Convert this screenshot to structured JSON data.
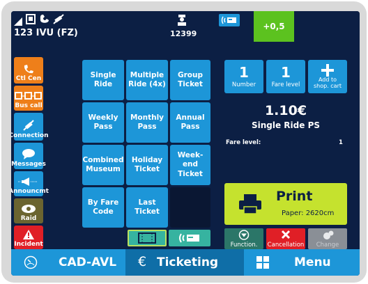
{
  "status": {
    "device_label": "123 IVU (FZ)",
    "driver_id": "12399",
    "balance": "+0,5",
    "balance_color": "#5cc21f"
  },
  "sidebar": {
    "items": [
      {
        "label": "Ctl Cen",
        "color": "#ee7f1a",
        "icon": "phone-icon"
      },
      {
        "label": "Bus call",
        "color": "#ee7f1a",
        "icon": "bus-call-icon"
      },
      {
        "label": "Connection",
        "color": "#1d96d8",
        "icon": "satellite-icon"
      },
      {
        "label": "Messages",
        "color": "#1d96d8",
        "icon": "message-icon"
      },
      {
        "label": "Announcmt",
        "color": "#1d96d8",
        "icon": "megaphone-icon"
      },
      {
        "label": "Raid",
        "color": "#6b6430",
        "icon": "eye-icon"
      },
      {
        "label": "Incident",
        "color": "#e01f26",
        "icon": "warning-icon"
      }
    ]
  },
  "tickets": {
    "single_ride": "Single Ride",
    "multiple_ride": [
      "Multiple",
      "Ride (4x)"
    ],
    "group_ticket": [
      "Group",
      "Ticket"
    ],
    "weekly_pass": [
      "Weekly",
      "Pass"
    ],
    "monthly_pass": [
      "Monthly",
      "Pass"
    ],
    "annual_pass": [
      "Annual",
      "Pass"
    ],
    "combined_museum": [
      "Combined",
      "Museum"
    ],
    "holiday_ticket": [
      "Holiday",
      "Ticket"
    ],
    "weekend_ticket": [
      "Week-end",
      "Ticket"
    ],
    "by_fare_code": [
      "By Fare",
      "Code"
    ],
    "last_ticket": "Last Ticket"
  },
  "counters": {
    "number_value": "1",
    "number_label": "Number",
    "fare_level_value": "1",
    "fare_level_label": "Fare level",
    "add_label": [
      "Add to",
      "shop. cart"
    ]
  },
  "summary": {
    "price": "1.10€",
    "ticket_name": "Single Ride PS",
    "fare_level_label": "Fare level:",
    "fare_level_value": "1"
  },
  "print": {
    "label": "Print",
    "paper": "Paper: 2620cm",
    "color": "#c5e22e"
  },
  "actions": {
    "function_label": "Function.",
    "cancellation_label": "Cancellation",
    "change_label": "Change"
  },
  "bottom_nav": {
    "cad_avl": "CAD-AVL",
    "ticketing": "Ticketing",
    "menu": "Menu"
  }
}
